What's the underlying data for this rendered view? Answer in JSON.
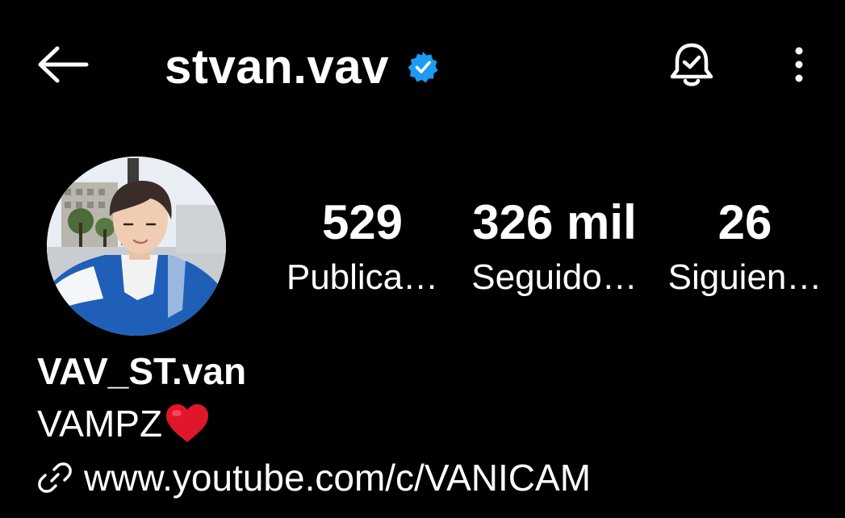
{
  "header": {
    "back_icon": "arrow-left-icon",
    "username": "stvan.vav",
    "verified_icon": "verified-badge-icon",
    "verified_color": "#1d9bf0",
    "bell_icon": "bell-check-icon",
    "more_icon": "more-vertical-icon"
  },
  "profile": {
    "avatar_icon": "profile-photo",
    "stats": [
      {
        "value": "529",
        "label": "Publica…"
      },
      {
        "value": "326 mil",
        "label": "Seguido…"
      },
      {
        "value": "26",
        "label": "Siguien…"
      }
    ],
    "display_name": "VAV_ST.van",
    "bio": "VAMPZ",
    "bio_emoji_icon": "red-heart-icon",
    "link_icon": "link-icon",
    "link": "www.youtube.com/c/VANICAM"
  },
  "colors": {
    "background": "#000000",
    "text": "#ffffff",
    "heart": "#e0162b"
  }
}
